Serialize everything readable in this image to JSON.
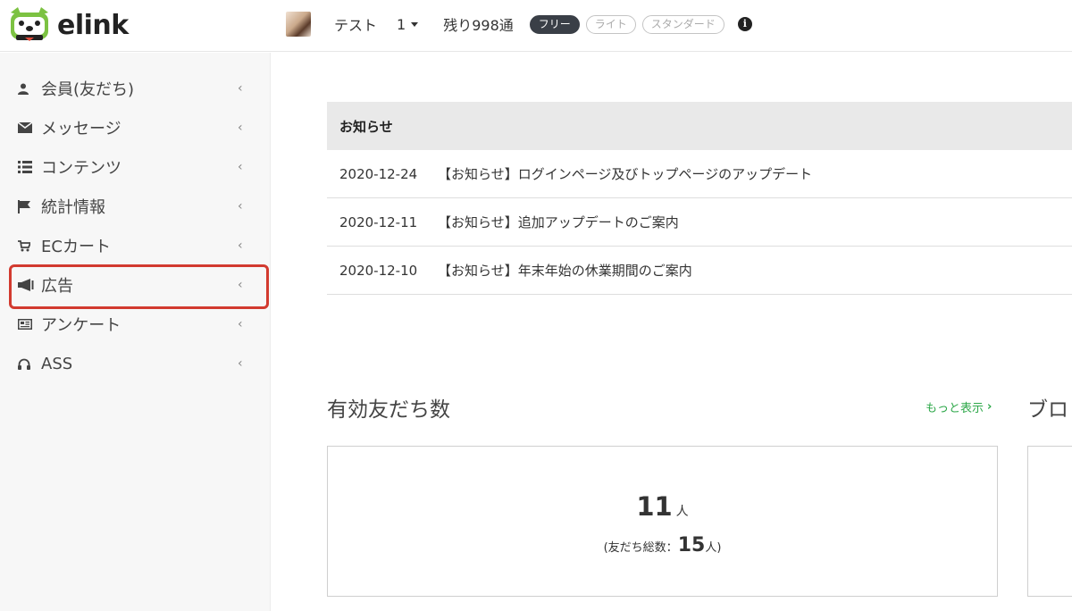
{
  "app": {
    "logo_text": "elink"
  },
  "header": {
    "username": "テスト",
    "account_number": "1",
    "remaining": "残り998通",
    "plans": [
      {
        "label": "フリー",
        "active": true
      },
      {
        "label": "ライト",
        "active": false
      },
      {
        "label": "スタンダード",
        "active": false
      }
    ],
    "info_icon": "info-circle-icon"
  },
  "sidebar": {
    "items": [
      {
        "label": "会員(友だち)",
        "icon": "user-icon"
      },
      {
        "label": "メッセージ",
        "icon": "envelope-icon"
      },
      {
        "label": "コンテンツ",
        "icon": "list-icon"
      },
      {
        "label": "統計情報",
        "icon": "flag-icon"
      },
      {
        "label": "ECカート",
        "icon": "cart-icon"
      },
      {
        "label": "広告",
        "icon": "megaphone-icon",
        "highlighted": true
      },
      {
        "label": "アンケート",
        "icon": "newspaper-icon"
      },
      {
        "label": "ASS",
        "icon": "headphones-icon"
      }
    ],
    "chevron": "‹"
  },
  "notices": {
    "header": "お知らせ",
    "rows": [
      {
        "date": "2020-12-24",
        "title": "【お知らせ】ログインページ及びトップページのアップデート"
      },
      {
        "date": "2020-12-11",
        "title": "【お知らせ】追加アップデートのご案内"
      },
      {
        "date": "2020-12-10",
        "title": "【お知らせ】年末年始の休業期間のご案内"
      }
    ]
  },
  "friends": {
    "title": "有効友だち数",
    "more_label": "もっと表示",
    "count": "11",
    "count_unit": "人",
    "total_prefix": "(友だち総数：",
    "total": "15",
    "total_suffix": "人)"
  },
  "broadcast": {
    "title_partial": "ブロ"
  },
  "colors": {
    "highlight": "#d23a2f",
    "more_link": "#2ea84a",
    "active_plan": "#3a3f47"
  }
}
